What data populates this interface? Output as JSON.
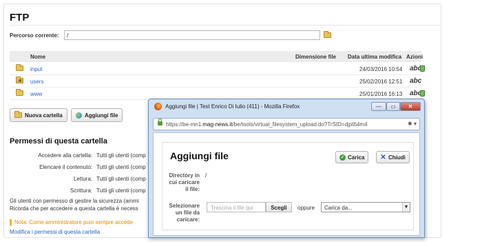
{
  "ftp": {
    "title": "FTP",
    "path_label": "Percorso corrente:",
    "path_value": "/"
  },
  "table": {
    "headers": {
      "name": "Nome",
      "size": "Dimensione file",
      "date": "Data ultima modifica",
      "actions": "Azioni"
    },
    "rows": [
      {
        "name": "input",
        "date": "24/03/2016 10:54"
      },
      {
        "name": "users",
        "date": "25/02/2016 12:51"
      },
      {
        "name": "www",
        "date": "25/01/2016 16:13"
      }
    ],
    "action_icon_text": "abc"
  },
  "buttons": {
    "new_folder": "Nuova cartella",
    "add_file": "Aggiungi file"
  },
  "permissions": {
    "title": "Permessi di questa cartella",
    "items": [
      {
        "label": "Accedere alla cartella:",
        "value": "Tutti gli utenti (comp"
      },
      {
        "label": "Elencare il contenuto:",
        "value": "Tutti gli utenti (comp"
      },
      {
        "label": "Lettura:",
        "value": "Tutti gli utenti (comp"
      },
      {
        "label": "Scrittura:",
        "value": "Tutti gli utenti (comp"
      }
    ],
    "note1": "Gli utenti con permesso di gestire la sicurezza (ammi",
    "note2": "Ricorda che per accedere a questa cartella è necess",
    "warning": "Nota: Come amministratore puoi sempre accede",
    "modify_link": "Modifica i permessi di questa cartella"
  },
  "dialog": {
    "window_title": "Aggiungi file | Test Enrico Di Iulio (411) - Mozilla Firefox",
    "url_prefix": "https://be-mn1.",
    "url_domain": "mag-news.it",
    "url_rest": "/be/tools/virtual_filesystem_upload.do?TrSID=djpt64m4",
    "heading": "Aggiungi file",
    "load_button": "Carica",
    "close_button": "Chiudi",
    "directory_label": "Directory in cui caricare il file:",
    "directory_value": "/",
    "select_label": "Selezionare un file da caricare:",
    "drop_placeholder": "Trascina il file qui",
    "choose_button": "Scegli",
    "or_text": "oppure",
    "select_value": "Carica da..."
  },
  "colors": {
    "link": "#2a64b8",
    "warning": "#e08a00",
    "folder": "#e6c257"
  }
}
